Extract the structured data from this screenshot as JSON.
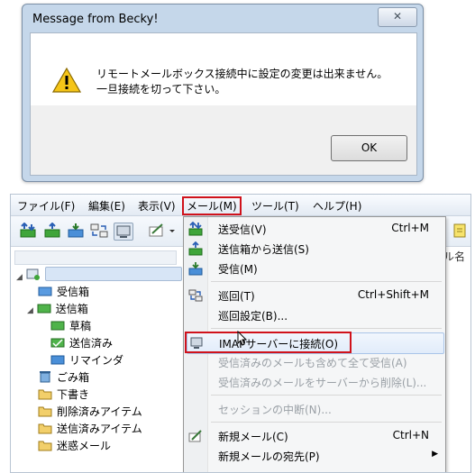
{
  "dialog": {
    "title": "Message from Becky!",
    "close_label": "✕",
    "message_line1": "リモートメールボックス接続中に設定の変更は出来ません。",
    "message_line2": "一旦接続を切って下さい。",
    "ok_label": "OK"
  },
  "menubar": {
    "items": [
      {
        "label": "ファイル(F)"
      },
      {
        "label": "編集(E)"
      },
      {
        "label": "表示(V)"
      },
      {
        "label": "メール(M)"
      },
      {
        "label": "ツール(T)"
      },
      {
        "label": "ヘルプ(H)"
      }
    ]
  },
  "tree": {
    "items": [
      {
        "label": "受信箱"
      },
      {
        "label": "送信箱"
      },
      {
        "label": "草稿"
      },
      {
        "label": "送信済み"
      },
      {
        "label": "リマインダ"
      },
      {
        "label": "ごみ箱"
      },
      {
        "label": "下書き"
      },
      {
        "label": "削除済みアイテム"
      },
      {
        "label": "送信済みアイテム"
      },
      {
        "label": "迷惑メール"
      }
    ]
  },
  "right_column": {
    "header_fragment": "ル名"
  },
  "dropdown": {
    "items": [
      {
        "label": "送受信(V)",
        "shortcut": "Ctrl+M"
      },
      {
        "label": "送信箱から送信(S)",
        "shortcut": ""
      },
      {
        "label": "受信(M)",
        "shortcut": ""
      },
      {
        "label": "巡回(T)",
        "shortcut": "Ctrl+Shift+M"
      },
      {
        "label": "巡回設定(B)...",
        "shortcut": ""
      },
      {
        "label": "IMAPサーバーに接続(O)",
        "shortcut": ""
      },
      {
        "label": "受信済みのメールも含めて全て受信(A)",
        "shortcut": ""
      },
      {
        "label": "受信済みのメールをサーバーから削除(L)...",
        "shortcut": ""
      },
      {
        "label": "セッションの中断(N)...",
        "shortcut": ""
      },
      {
        "label": "新規メール(C)",
        "shortcut": "Ctrl+N"
      },
      {
        "label": "新規メールの宛先(P)",
        "shortcut": ""
      }
    ]
  },
  "colors": {
    "highlight_red": "#d0121b",
    "dialog_frame": "#c5d7ea",
    "disabled_text": "#9aa0a6"
  }
}
